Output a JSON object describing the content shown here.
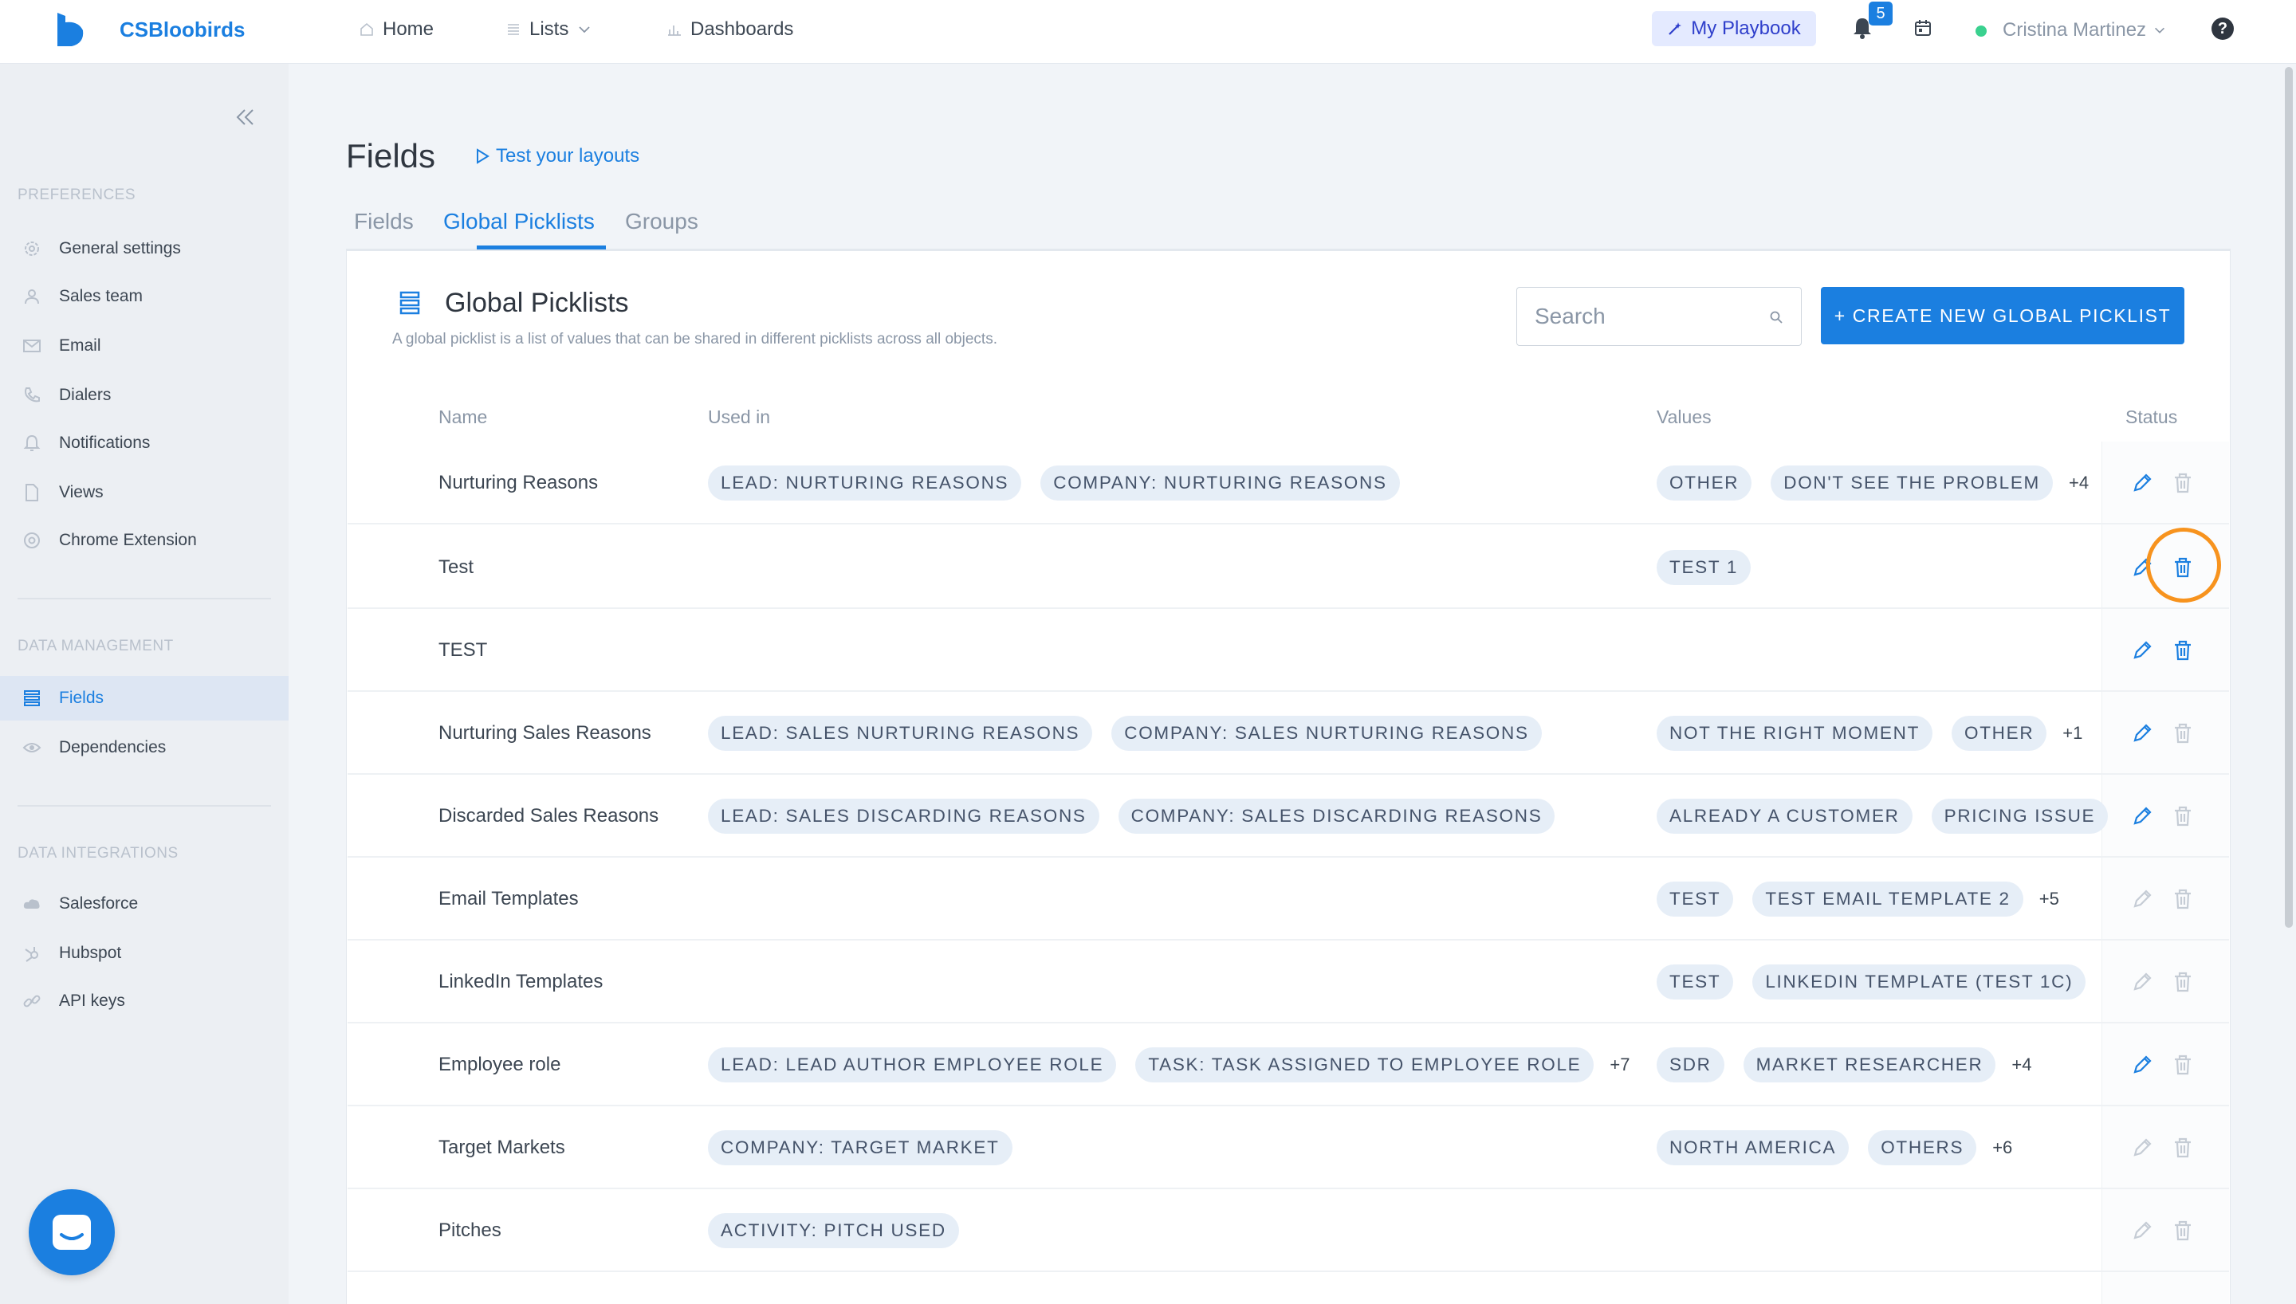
{
  "app": {
    "brand": "CSBloobirds",
    "accent_color": "#1b7fe0",
    "highlight_color": "#f7931e"
  },
  "topbar": {
    "nav": [
      {
        "label": "Home",
        "icon": "home-icon"
      },
      {
        "label": "Lists",
        "icon": "list-icon"
      },
      {
        "label": "Dashboards",
        "icon": "bar-chart-icon"
      }
    ],
    "playbook_label": "My Playbook",
    "notifications_count": "5",
    "user_name": "Cristina Martinez",
    "help_label": "?"
  },
  "sidebar": {
    "sections": [
      {
        "title": "PREFERENCES",
        "items": [
          {
            "label": "General settings",
            "icon": "gear-icon"
          },
          {
            "label": "Sales team",
            "icon": "user-icon"
          },
          {
            "label": "Email",
            "icon": "mail-icon"
          },
          {
            "label": "Dialers",
            "icon": "phone-icon"
          },
          {
            "label": "Notifications",
            "icon": "bell-icon"
          },
          {
            "label": "Views",
            "icon": "document-icon"
          },
          {
            "label": "Chrome Extension",
            "icon": "chrome-icon"
          }
        ]
      },
      {
        "title": "DATA MANAGEMENT",
        "items": [
          {
            "label": "Fields",
            "icon": "list-icon",
            "active": true
          },
          {
            "label": "Dependencies",
            "icon": "eye-icon"
          }
        ]
      },
      {
        "title": "DATA INTEGRATIONS",
        "items": [
          {
            "label": "Salesforce",
            "icon": "cloud-icon"
          },
          {
            "label": "Hubspot",
            "icon": "hubspot-icon"
          },
          {
            "label": "API keys",
            "icon": "link-icon"
          }
        ]
      }
    ]
  },
  "page": {
    "title": "Fields",
    "test_layouts_label": "Test your layouts",
    "tabs": [
      {
        "label": "Fields"
      },
      {
        "label": "Global Picklists",
        "active": true
      },
      {
        "label": "Groups"
      }
    ]
  },
  "card": {
    "title": "Global Picklists",
    "description": "A global picklist is a list of values that can be shared in different picklists across all objects.",
    "search_placeholder": "Search",
    "create_label": "+ CREATE NEW GLOBAL PICKLIST"
  },
  "table": {
    "columns": [
      "Name",
      "Used in",
      "Values",
      "Status"
    ],
    "rows": [
      {
        "name": "Nurturing Reasons",
        "used_in": [
          "LEAD: NURTURING REASONS",
          "COMPANY: NURTURING REASONS"
        ],
        "used_more": "",
        "values": [
          "OTHER",
          "DON'T SEE THE PROBLEM"
        ],
        "values_more": "+4",
        "editable": true,
        "deletable": false
      },
      {
        "name": "Test",
        "used_in": [],
        "used_more": "",
        "values": [
          "TEST 1"
        ],
        "values_more": "",
        "editable": true,
        "deletable": true
      },
      {
        "name": "TEST",
        "used_in": [],
        "used_more": "",
        "values": [],
        "values_more": "",
        "editable": true,
        "deletable": true
      },
      {
        "name": "Nurturing Sales Reasons",
        "used_in": [
          "LEAD: SALES NURTURING REASONS",
          "COMPANY: SALES NURTURING REASONS"
        ],
        "used_more": "",
        "values": [
          "NOT THE RIGHT MOMENT",
          "OTHER"
        ],
        "values_more": "+1",
        "editable": true,
        "deletable": false
      },
      {
        "name": "Discarded Sales Reasons",
        "used_in": [
          "LEAD: SALES DISCARDING REASONS",
          "COMPANY: SALES DISCARDING REASONS"
        ],
        "used_more": "",
        "values": [
          "ALREADY A CUSTOMER",
          "PRICING ISSUE"
        ],
        "values_more": "",
        "editable": true,
        "deletable": false
      },
      {
        "name": "Email Templates",
        "used_in": [],
        "used_more": "",
        "values": [
          "TEST",
          "TEST EMAIL TEMPLATE 2"
        ],
        "values_more": "+5",
        "editable": false,
        "deletable": false
      },
      {
        "name": "LinkedIn Templates",
        "used_in": [],
        "used_more": "",
        "values": [
          "TEST",
          "LINKEDIN TEMPLATE (TEST 1C)"
        ],
        "values_more": "",
        "editable": false,
        "deletable": false
      },
      {
        "name": "Employee role",
        "used_in": [
          "LEAD: LEAD AUTHOR EMPLOYEE ROLE",
          "TASK: TASK ASSIGNED TO EMPLOYEE ROLE"
        ],
        "used_more": "+7",
        "values": [
          "SDR",
          "MARKET RESEARCHER"
        ],
        "values_more": "+4",
        "editable": true,
        "deletable": false
      },
      {
        "name": "Target Markets",
        "used_in": [
          "COMPANY: TARGET MARKET"
        ],
        "used_more": "",
        "values": [
          "NORTH AMERICA",
          "OTHERS"
        ],
        "values_more": "+6",
        "editable": false,
        "deletable": false
      },
      {
        "name": "Pitches",
        "used_in": [
          "ACTIVITY: PITCH USED"
        ],
        "used_more": "",
        "values": [],
        "values_more": "",
        "editable": false,
        "deletable": false
      }
    ]
  }
}
